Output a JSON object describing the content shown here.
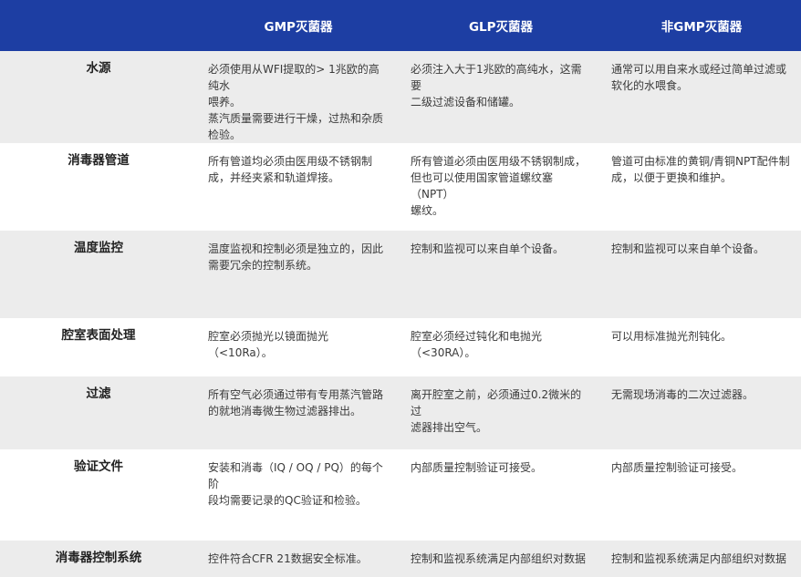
{
  "header": {
    "col0": "",
    "col1": "GMP灭菌器",
    "col2": "GLP灭菌器",
    "col3": "非GMP灭菌器"
  },
  "rows": [
    {
      "label": "水源",
      "gmp": "必须使用从WFI提取的> 1兆欧的高纯水\n喂养。\n蒸汽质量需要进行干燥，过热和杂质\n检验。",
      "glp": "必须注入大于1兆欧的高纯水，这需要\n二级过滤设备和储罐。",
      "nongmp": "通常可以用自来水或经过简单过滤或\n软化的水喂食。"
    },
    {
      "label": "消毒器管道",
      "gmp": "所有管道均必须由医用级不锈钢制\n成，并经夹紧和轨道焊接。",
      "glp": "所有管道必须由医用级不锈钢制成，\n但也可以使用国家管道螺纹塞（NPT）\n螺纹。",
      "nongmp": "管道可由标准的黄铜/青铜NPT配件制\n成，以便于更换和维护。"
    },
    {
      "label": "温度监控",
      "gmp": "温度监视和控制必须是独立的，因此\n需要冗余的控制系统。",
      "glp": "控制和监视可以来自单个设备。",
      "nongmp": "控制和监视可以来自单个设备。"
    },
    {
      "label": "腔室表面处理",
      "gmp": "腔室必须抛光以镜面抛光（<10Ra）。",
      "glp": "腔室必须经过钝化和电抛光\n（<30RA）。",
      "nongmp": "可以用标准抛光剂钝化。"
    },
    {
      "label": "过滤",
      "gmp": "所有空气必须通过带有专用蒸汽管路\n的就地消毒微生物过滤器排出。",
      "glp": "离开腔室之前，必须通过0.2微米的过\n滤器排出空气。",
      "nongmp": "无需现场消毒的二次过滤器。"
    },
    {
      "label": "验证文件",
      "gmp": "安装和消毒（IQ / OQ / PQ）的每个阶\n段均需要记录的QC验证和检验。",
      "glp": "内部质量控制验证可接受。",
      "nongmp": "内部质量控制验证可接受。"
    },
    {
      "label": "消毒器控制系统",
      "gmp": "控件符合CFR 21数据安全标准。",
      "glp": "控制和监视系统满足内部组织对数据",
      "nongmp": "控制和监视系统满足内部组织对数据"
    }
  ]
}
